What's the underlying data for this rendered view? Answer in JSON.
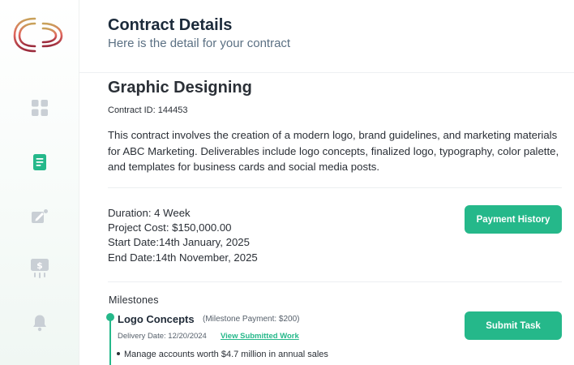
{
  "header": {
    "title": "Contract Details",
    "subtitle": "Here is the detail for your contract"
  },
  "sidebar": {
    "logo": "brand-logo",
    "items": [
      {
        "icon": "grid-icon",
        "active": false
      },
      {
        "icon": "document-icon",
        "active": true
      },
      {
        "icon": "edit-icon",
        "active": false
      },
      {
        "icon": "payment-icon",
        "active": false
      },
      {
        "icon": "bell-icon",
        "active": false
      }
    ]
  },
  "contract": {
    "title": "Graphic Designing",
    "id_label": "Contract ID: 144453",
    "description": "This contract involves the creation of a modern logo, brand guidelines, and marketing materials for ABC Marketing. Deliverables include logo concepts, finalized logo, typography, color palette, and templates for business cards and social media posts.",
    "duration": "Duration: 4 Week",
    "project_cost": "Project Cost: $150,000.00",
    "start_date": "Start Date:14th January, 2025",
    "end_date": "End Date:14th November, 2025",
    "payment_history_label": "Payment History"
  },
  "milestones": {
    "heading": "Milestones",
    "items": [
      {
        "title": "Logo Concepts",
        "payment": "(Milestone Payment: $200)",
        "delivery_date": "Delivery Date: 12/20/2024",
        "view_link": "View Submitted Work",
        "submit_label": "Submit Task",
        "bullets": [
          "Manage accounts worth $4.7 million in annual sales"
        ]
      }
    ]
  },
  "colors": {
    "accent": "#25b88a",
    "title": "#1b2a3a",
    "subtitle": "#5b7083",
    "icon_inactive": "#c9cfd5"
  }
}
